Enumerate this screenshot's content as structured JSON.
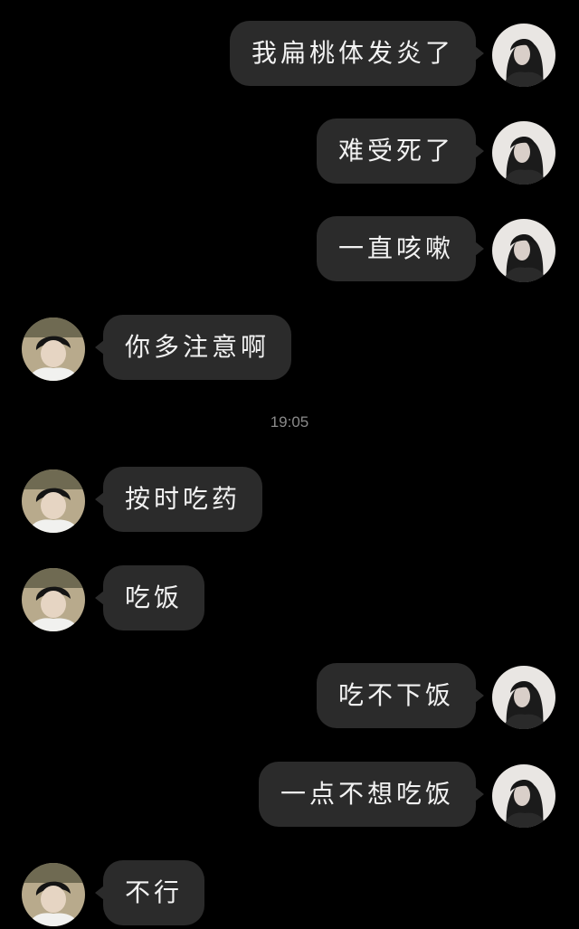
{
  "messages": [
    {
      "side": "outgoing",
      "text": "我扁桃体发炎了"
    },
    {
      "side": "outgoing",
      "text": "难受死了"
    },
    {
      "side": "outgoing",
      "text": "一直咳嗽"
    },
    {
      "side": "incoming",
      "text": "你多注意啊"
    },
    {
      "side": "incoming",
      "text": "按时吃药"
    },
    {
      "side": "incoming",
      "text": "吃饭"
    },
    {
      "side": "outgoing",
      "text": "吃不下饭"
    },
    {
      "side": "outgoing",
      "text": "一点不想吃饭"
    },
    {
      "side": "incoming",
      "text": "不行"
    }
  ],
  "timestamp": "19:05",
  "colors": {
    "background": "#000000",
    "bubble": "#2b2b2b",
    "bubble_text": "#f2f2f2",
    "timestamp_text": "#8a8a8a"
  },
  "icons": {
    "outgoing_avatar": "girl-avatar-icon",
    "incoming_avatar": "boy-avatar-icon"
  }
}
